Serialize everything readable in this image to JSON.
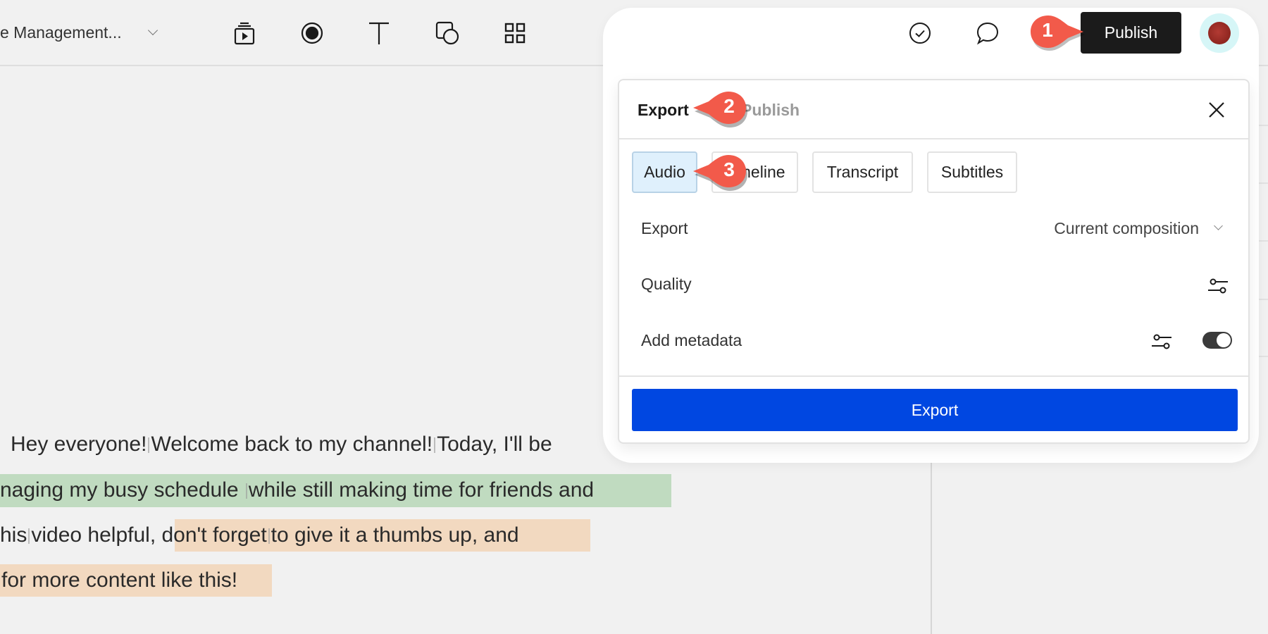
{
  "topbar": {
    "project_title": "e Management...",
    "tools": [
      {
        "name": "scene-icon"
      },
      {
        "name": "record-icon"
      },
      {
        "name": "text-icon"
      },
      {
        "name": "shape-icon"
      },
      {
        "name": "grid-icon"
      }
    ]
  },
  "header": {
    "check_icon": "check-circle-icon",
    "comment_icon": "comment-icon",
    "publish_label": "Publish",
    "avatar_color": "#b23a33"
  },
  "panel": {
    "tabs": [
      {
        "label": "Export",
        "active": true
      },
      {
        "label": "Publish",
        "active": false
      }
    ],
    "formats": [
      {
        "label": "Audio",
        "selected": true
      },
      {
        "label": "Timeline",
        "selected": false
      },
      {
        "label": "Transcript",
        "selected": false
      },
      {
        "label": "Subtitles",
        "selected": false
      }
    ],
    "rows": {
      "export": {
        "label": "Export",
        "value": "Current composition"
      },
      "quality": {
        "label": "Quality"
      },
      "metadata": {
        "label": "Add metadata",
        "toggle_on": true
      }
    },
    "export_button": "Export",
    "accent_color": "#0047e1"
  },
  "transcript": {
    "lines": [
      {
        "segments": [
          "Hey everyone!",
          "Welcome back to my channel!",
          "Today, I'll be"
        ]
      },
      {
        "segments": [
          "naging my busy schedule ",
          "while still making time for friends and"
        ]
      },
      {
        "segments": [
          "his",
          "video helpful,",
          "don't forget",
          "to give it a thumbs up, and"
        ]
      },
      {
        "segments": [
          "for more content like this!"
        ]
      }
    ]
  },
  "callouts": [
    "1",
    "2",
    "3"
  ]
}
